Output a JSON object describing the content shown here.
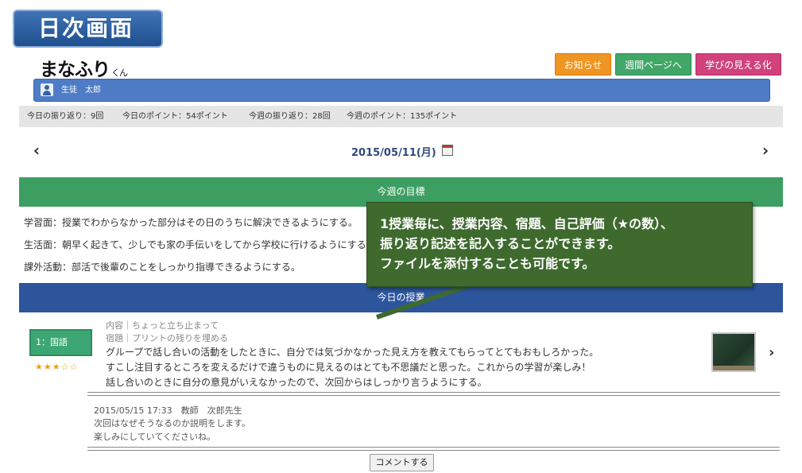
{
  "screen_title": "日次画面",
  "app": {
    "logo": "まなふり",
    "logo_suffix": "くん"
  },
  "header_buttons": {
    "notice": "お知らせ",
    "weekly": "週間ページへ",
    "visualize": "学びの見える化"
  },
  "user": {
    "name": "生徒　太郎"
  },
  "stats": {
    "today_reflections": "今日の振り返り：9回",
    "today_points": "今日のポイント：54ポイント",
    "week_reflections": "今週の振り返り：28回",
    "week_points": "今週のポイント：135ポイント"
  },
  "date": {
    "label": "2015/05/11(月)",
    "prev": "‹",
    "next": "›"
  },
  "weekly_goal": {
    "header": "今週の目標",
    "lines": [
      "学習面：授業でわからなかった部分はその日のうちに解決できるようにする。",
      "生活面：朝早く起きて、少しでも家の手伝いをしてから学校に行けるようにする。",
      "課外活動：部活で後輩のことをしっかり指導できるようにする。"
    ]
  },
  "today_classes": {
    "header": "今日の授業",
    "lesson": {
      "subject": "1：国語",
      "stars": "★★★☆☆",
      "content": "内容｜ちょっと立ち止まって",
      "homework": "宿題｜プリントの残りを埋める",
      "reflection": [
        "グループで話し合いの活動をしたときに、自分では気づかなかった見え方を教えてもらってとてもおもしろかった。",
        "すこし注目するところを変えるだけで違うものに見えるのはとても不思議だと思った。これからの学習が楽しみ！",
        "話し合いのときに自分の意見がいえなかったので、次回からはしっかり言うようにする。"
      ],
      "arrow": "›"
    },
    "comment": {
      "meta": "2015/05/15 17:33　教師　次郎先生",
      "lines": [
        "次回はなぜそうなるのか説明をします。",
        "楽しみにしていてくださいね。"
      ]
    },
    "comment_button": "コメントする"
  },
  "callout": {
    "lines": [
      "1授業毎に、授業内容、宿題、自己評価（★の数）、",
      "振り返り記述を記入することができます。",
      "ファイルを添付することも可能です。"
    ]
  },
  "colors": {
    "goal_header": "#3d9e62",
    "class_header": "#2c559c",
    "user_bar": "#4f7cc6",
    "notice_button": "#ef9521",
    "weekly_button": "#41a768",
    "visualize_button": "#d1417c",
    "callout": "#3e6a2e"
  }
}
